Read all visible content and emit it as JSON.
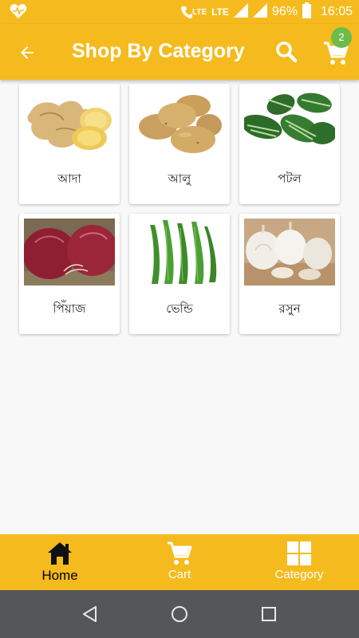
{
  "status_bar": {
    "lte1": "LTE",
    "lte2": "LTE",
    "battery": "96%",
    "time": "16:05"
  },
  "app_bar": {
    "title": "Shop By Category",
    "cart_count": "2"
  },
  "categories": [
    {
      "label": "আদা",
      "icon": "ginger-image"
    },
    {
      "label": "আলু",
      "icon": "potato-image"
    },
    {
      "label": "পটল",
      "icon": "pointed-gourd-image"
    },
    {
      "label": "পিঁয়াজ",
      "icon": "onion-image"
    },
    {
      "label": "ভেন্ডি",
      "icon": "okra-image"
    },
    {
      "label": "রসুন",
      "icon": "garlic-image"
    }
  ],
  "bottom_nav": {
    "home": "Home",
    "cart": "Cart",
    "category": "Category"
  },
  "colors": {
    "accent": "#f5bb1e",
    "badge": "#6dbb4a",
    "system_nav": "#53575a"
  }
}
